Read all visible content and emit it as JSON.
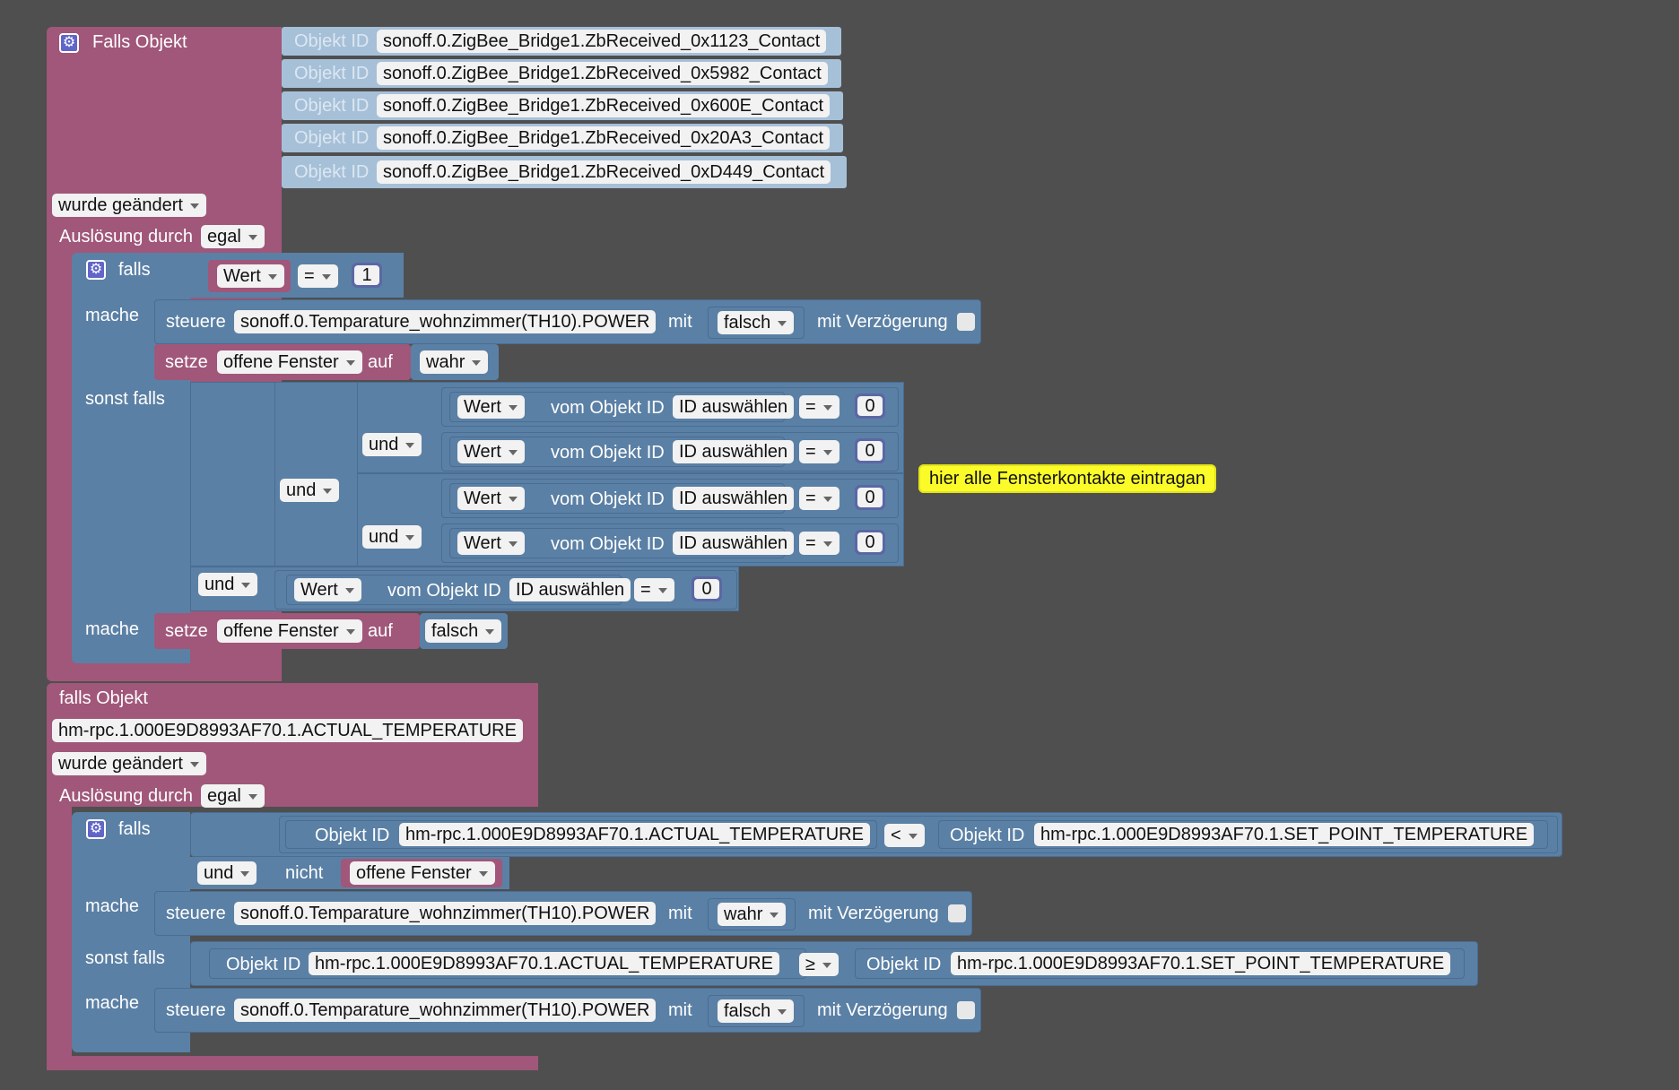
{
  "colors": {
    "workspace": "#4f4f4f",
    "event_block": "#a0577a",
    "logic_block": "#5b80a5",
    "object_id_block": "#a6c0d8",
    "number_block": "#5b67a5",
    "comment": "#fbfb2a"
  },
  "icons": {
    "settings": "gear-icon",
    "dropdown": "triangle-down-icon"
  },
  "block1": {
    "header": "Falls Objekt",
    "object_id_label": "Objekt ID",
    "object_ids": [
      "sonoff.0.ZigBee_Bridge1.ZbReceived_0x1123_Contact",
      "sonoff.0.ZigBee_Bridge1.ZbReceived_0x5982_Contact",
      "sonoff.0.ZigBee_Bridge1.ZbReceived_0x600E_Contact",
      "sonoff.0.ZigBee_Bridge1.ZbReceived_0x20A3_Contact",
      "sonoff.0.ZigBee_Bridge1.ZbReceived_0xD449_Contact"
    ],
    "trigger": "wurde geändert",
    "ack_label": "Auslösung durch",
    "ack_value": "egal",
    "if_label": "falls",
    "if_field": "Wert",
    "if_op": "=",
    "if_value": "1",
    "do_label": "mache",
    "control_label": "steuere",
    "control_target": "sonoff.0.Temparature_wohnzimmer(TH10).POWER",
    "with_label": "mit",
    "control_value": "falsch",
    "delay_label": "mit Verzögerung",
    "set_label": "setze",
    "var_name": "offene Fenster",
    "to_label": "auf",
    "set_value": "wahr",
    "elseif_label": "sonst falls",
    "and_label": "und",
    "field_label": "Wert",
    "from_object_label": "vom Objekt ID",
    "select_id": "ID auswählen",
    "cmp_op": "=",
    "cmp_value": "0",
    "do2_label": "mache",
    "set2_value": "falsch",
    "comment": "hier alle Fensterkontakte eintragan"
  },
  "block2": {
    "header": "falls Objekt",
    "object_id": "hm-rpc.1.000E9D8993AF70.1.ACTUAL_TEMPERATURE",
    "trigger": "wurde geändert",
    "ack_label": "Auslösung durch",
    "ack_value": "egal",
    "if_label": "falls",
    "object_id_label": "Objekt ID",
    "actual_temp": "hm-rpc.1.000E9D8993AF70.1.ACTUAL_TEMPERATURE",
    "lt_op": "<",
    "set_point_temp": "hm-rpc.1.000E9D8993AF70.1.SET_POINT_TEMPERATURE",
    "and_label": "und",
    "not_label": "nicht",
    "var_name": "offene Fenster",
    "do_label": "mache",
    "control_label": "steuere",
    "control_target": "sonoff.0.Temparature_wohnzimmer(TH10).POWER",
    "with_label": "mit",
    "control_value_true": "wahr",
    "delay_label": "mit Verzögerung",
    "elseif_label": "sonst falls",
    "ge_op": "≥",
    "do2_label": "mache",
    "control_value_false": "falsch"
  }
}
